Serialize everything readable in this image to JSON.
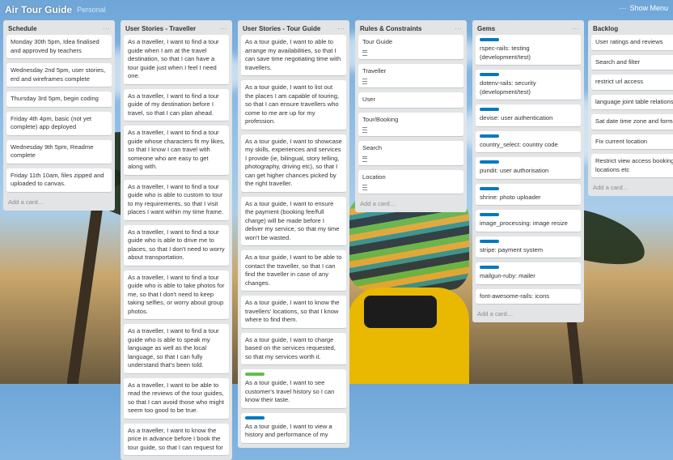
{
  "header": {
    "title": "Air Tour Guide",
    "subtitle": "Personal",
    "show_menu": "Show Menu"
  },
  "colors": {
    "label_blue": "#0079bf",
    "label_green": "#61bd4f",
    "list_bg": "#e2e4e6"
  },
  "lists": [
    {
      "title": "Schedule",
      "cards": [
        {
          "text": "Monday 30th 5pm, Idea finalised and approved by teachers"
        },
        {
          "text": "Wednesday 2nd 5pm, user stories, erd and wireframes complete"
        },
        {
          "text": "Thursday 3rd 5pm, begin coding"
        },
        {
          "text": "Friday 4th 4pm, basic (not yet complete) app deployed"
        },
        {
          "text": "Wednesday 9th 5pm, Readme complete"
        },
        {
          "text": "Friday 11th 10am, files zipped and uploaded to canvas."
        }
      ],
      "add": "Add a card…"
    },
    {
      "title": "User Stories - Traveller",
      "cards": [
        {
          "text": "As a traveller, I want to find a tour guide when I am at the travel destination, so that I can have a tour guide just when I feel I need one."
        },
        {
          "text": "As a traveller, I want to find a tour guide of my destination before I travel, so that I can plan ahead."
        },
        {
          "text": "As a traveller, I want to find a tour guide whose characters fit my likes, so that I know I can travel with someone who are easy to get along with."
        },
        {
          "text": "As a traveller, I want to find a tour guide who is able to custom to tour to my requirements, so that I visit places I want within my time frame."
        },
        {
          "text": "As a traveller, I want to find a tour guide who is able to drive me to places, so that I don't need to worry about transportation."
        },
        {
          "text": "As a traveller, I want to find a tour guide who is able to take photos for me, so that I don't need to keep taking selfies, or worry about group photos."
        },
        {
          "text": "As a traveller, I want to find a tour guide who is able to speak my language as well as the local language, so that I can fully understand that's been told."
        },
        {
          "text": "As a traveller, I want to be able to read the reviews of the tour guides, so that I can avoid those who might seem too good to be true."
        },
        {
          "text": "As a traveller, I want to know the price in advance before I book the tour guide, so that I can request for"
        }
      ]
    },
    {
      "title": "User Stories - Tour Guide",
      "cards": [
        {
          "text": "As a tour guide, I want to able to arrange my availabilities, so that I can save time negotiating time with travellers."
        },
        {
          "text": "As a tour guide, I want to list out the places I am capable of touring, so that I can ensure travellers who come to me are up for my profession."
        },
        {
          "text": "As a tour guide, I want to showcase my skills, experiences and services I provide (ie, bilingual, story telling, photography, driving etc), so that I can get higher chances picked by the right traveller."
        },
        {
          "text": "As a tour guide, I want to ensure the payment (booking fee/full charge) will be made before I deliver my service, so that my time won't be wasted."
        },
        {
          "text": "As a tour guide, I want to be able to contact the traveller, so that I can find the traveller in case of any changes."
        },
        {
          "text": "As a tour guide, I want to know the travellers' locations, so that I know where to find them."
        },
        {
          "text": "As a tour guide, I want to charge based on the services requested, so that my services worth it."
        },
        {
          "text": "As a tour guide, I want to see customer's travel history so I can know their taste.",
          "label": "green"
        },
        {
          "text": "As a tour guide, I want to view a history and performance of my",
          "label": "blue"
        }
      ]
    },
    {
      "title": "Rules & Constraints",
      "cards": [
        {
          "text": "Tour Guide",
          "desc": true
        },
        {
          "text": "Traveller",
          "desc": true
        },
        {
          "text": "User"
        },
        {
          "text": "Tour/Booking",
          "desc": true
        },
        {
          "text": "Search",
          "desc": true
        },
        {
          "text": "Location",
          "desc": true
        }
      ],
      "add": "Add a card…"
    },
    {
      "title": "Gems",
      "cards": [
        {
          "text": "rspec-rails: testing (development/test)",
          "label": "blue"
        },
        {
          "text": "dotenv-rails: security (development/test)",
          "label": "blue"
        },
        {
          "text": "devise: user authentication",
          "label": "blue"
        },
        {
          "text": "country_select: country code",
          "label": "blue"
        },
        {
          "text": "pundit: user authorisation",
          "label": "blue"
        },
        {
          "text": "shrine: photo uploader",
          "label": "blue"
        },
        {
          "text": "image_processing: image resize",
          "label": "blue"
        },
        {
          "text": "stripe: payment system",
          "label": "blue"
        },
        {
          "text": "mailgun-ruby: mailer",
          "label": "blue"
        },
        {
          "text": "font-awesome-rails: icons"
        }
      ],
      "add": "Add a card…"
    },
    {
      "title": "Backlog",
      "cards": [
        {
          "text": "User ratings and reviews"
        },
        {
          "text": "Search and filter"
        },
        {
          "text": "restrict url access"
        },
        {
          "text": "language joint table relationship"
        },
        {
          "text": "Sat date time zone and format"
        },
        {
          "text": "Fix current location"
        },
        {
          "text": "Restrict view access bookings locations etc"
        }
      ],
      "add": "Add a card…"
    }
  ]
}
